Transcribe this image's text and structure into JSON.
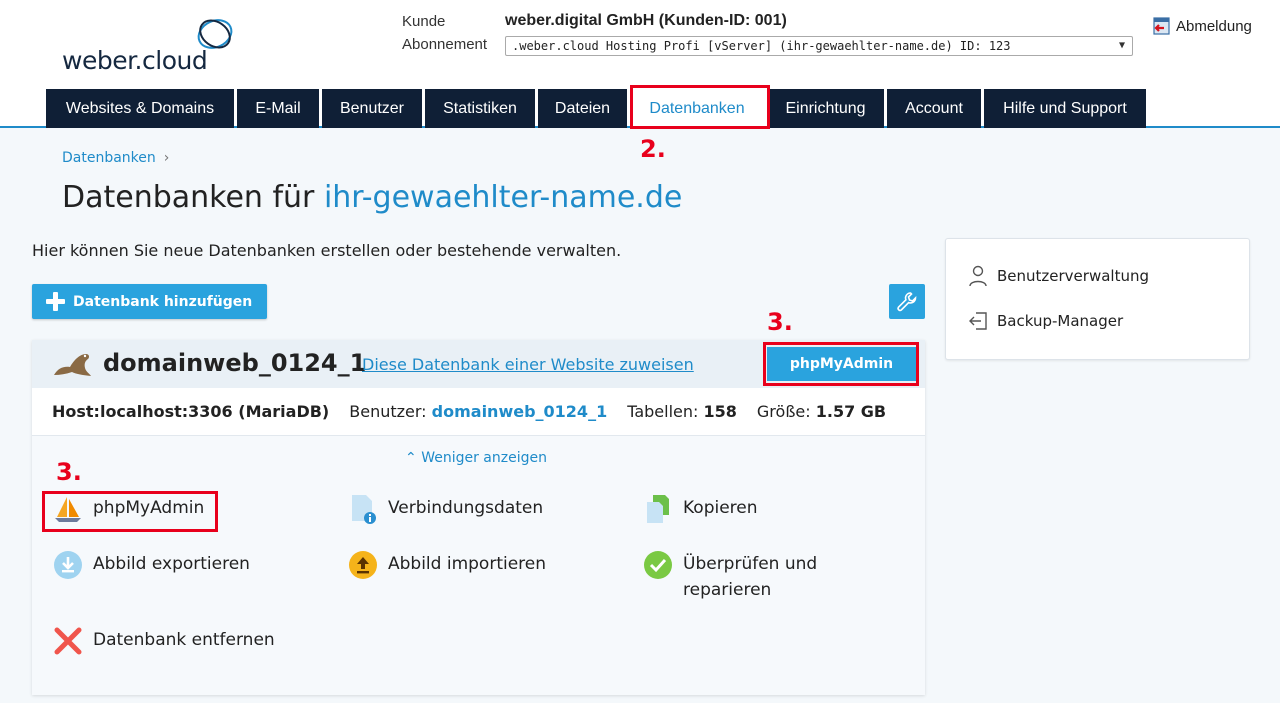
{
  "header": {
    "logo_text": "weber.cloud",
    "customer_label": "Kunde",
    "customer_value": "weber.digital GmbH (Kunden-ID: 001)",
    "subscription_label": "Abonnement",
    "subscription_value": ".weber.cloud Hosting Profi [vServer] (ihr-gewaehlter-name.de) ID: 123",
    "logout_label": "Abmeldung"
  },
  "nav": {
    "items": [
      {
        "label": "Websites & Domains"
      },
      {
        "label": "E-Mail"
      },
      {
        "label": "Benutzer"
      },
      {
        "label": "Statistiken"
      },
      {
        "label": "Dateien"
      },
      {
        "label": "Datenbanken",
        "active": true
      },
      {
        "label": "Einrichtung"
      },
      {
        "label": "Account"
      },
      {
        "label": "Hilfe und Support"
      }
    ]
  },
  "annotations": {
    "nav_step": "2.",
    "pma_step_top": "3.",
    "pma_step_bottom": "3."
  },
  "breadcrumb": {
    "item": "Datenbanken",
    "separator": "›"
  },
  "page": {
    "title_prefix": "Datenbanken für",
    "title_domain": "ihr-gewaehlter-name.de",
    "intro": "Hier können Sie neue Datenbanken erstellen oder bestehende verwalten.",
    "add_button": "Datenbank hinzufügen"
  },
  "database": {
    "name": "domainweb_0124_1",
    "assign_link": "Diese Datenbank einer Website zuweisen",
    "pma_button": "phpMyAdmin",
    "host_label": "Host:",
    "host_value": "localhost:3306 (MariaDB)",
    "user_label": "Benutzer:",
    "user_value": "domainweb_0124_1",
    "tables_label": "Tabellen:",
    "tables_value": "158",
    "size_label": "Größe:",
    "size_value": "1.57 GB",
    "toggle_label": "Weniger anzeigen",
    "actions": {
      "phpmyadmin": "phpMyAdmin",
      "connection": "Verbindungsdaten",
      "copy": "Kopieren",
      "export": "Abbild exportieren",
      "import": "Abbild importieren",
      "check_line1": "Überprüfen und",
      "check_line2": "reparieren",
      "remove": "Datenbank entfernen"
    }
  },
  "sidebar": {
    "user_management": "Benutzerverwaltung",
    "backup_manager": "Backup-Manager"
  },
  "colors": {
    "accent": "#1f8bc9",
    "nav_bg": "#0f1f36",
    "button": "#2aa3de",
    "highlight": "#e8001c"
  }
}
